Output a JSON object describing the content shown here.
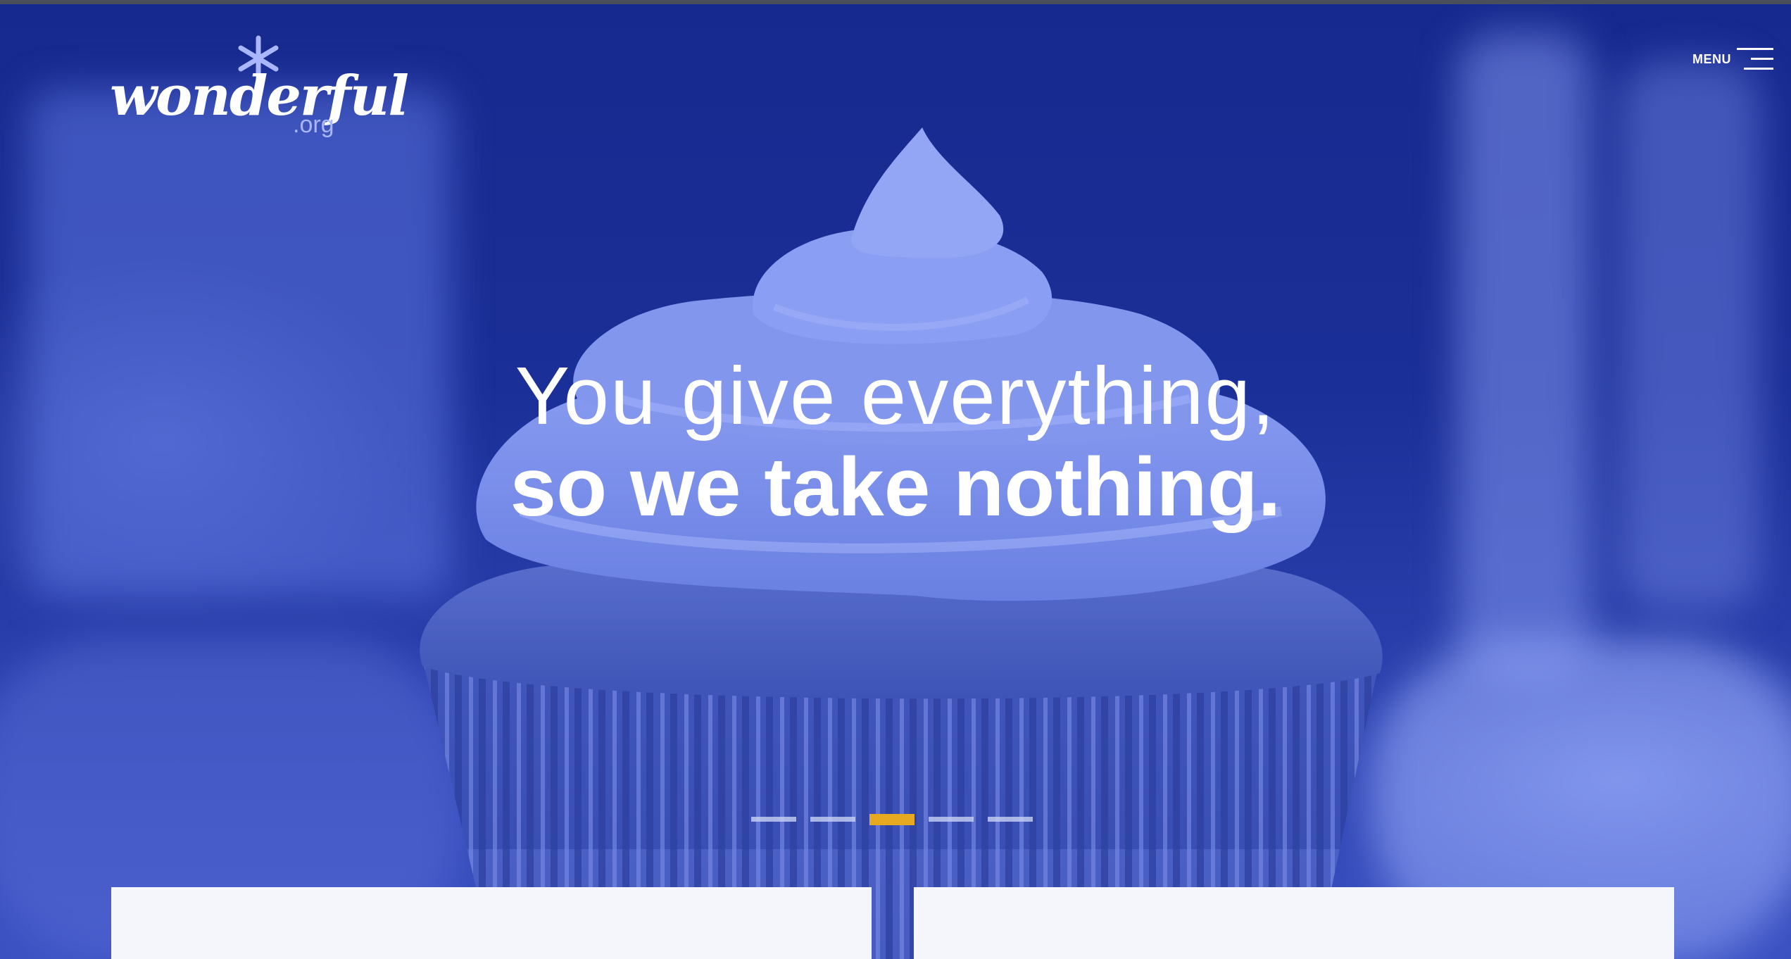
{
  "brand": {
    "logo_word": "wonderful",
    "logo_suffix": ".org"
  },
  "header": {
    "menu_label": "MENU"
  },
  "hero": {
    "headline_line1": "You give everything,",
    "headline_line2": "so we take nothing.",
    "slides": [
      {
        "active": false
      },
      {
        "active": false
      },
      {
        "active": true
      },
      {
        "active": false
      },
      {
        "active": false
      }
    ]
  },
  "cards": [
    {
      "title": ""
    },
    {
      "title": ""
    }
  ],
  "colors": {
    "hero_overlay": "#1b2f98",
    "accent": "#e6a91f",
    "text": "#ffffff",
    "logo_suffix": "#aab6ff",
    "card_background": "#f4f6fc"
  },
  "icons": {
    "menu": "hamburger-icon",
    "logo_mark": "asterisk-star-icon"
  }
}
